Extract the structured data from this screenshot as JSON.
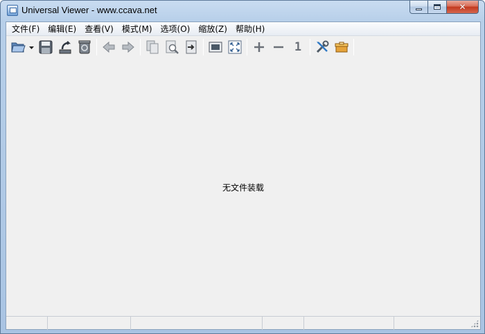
{
  "window": {
    "title": "Universal Viewer - www.ccava.net",
    "buttons": {
      "minimize_icon": "minimize-icon",
      "maximize_icon": "maximize-icon",
      "close_icon": "close-icon",
      "close_glyph": "✕"
    }
  },
  "menu": [
    {
      "label": "文件(F)"
    },
    {
      "label": "编辑(E)"
    },
    {
      "label": "查看(V)"
    },
    {
      "label": "模式(M)"
    },
    {
      "label": "选项(O)"
    },
    {
      "label": "缩放(Z)"
    },
    {
      "label": "帮助(H)"
    }
  ],
  "toolbar": {
    "groups": [
      [
        "open-icon",
        "dropdown-arrow-icon",
        "save-icon",
        "reload-icon",
        "delete-icon"
      ],
      [
        "back-arrow-icon",
        "forward-arrow-icon"
      ],
      [
        "copy-icon",
        "find-icon",
        "exit-to-icon"
      ],
      [
        "fullscreen-window-icon",
        "fit-screen-icon"
      ],
      [
        "zoom-in-icon",
        "zoom-out-icon",
        "original-size-icon"
      ],
      [
        "settings-tools-icon",
        "plugin-box-icon"
      ]
    ],
    "original_size_label": "1"
  },
  "viewer": {
    "empty_message": "无文件装载"
  },
  "statusbar": {
    "panes": [
      "",
      "",
      "",
      "",
      "",
      ""
    ]
  },
  "colors": {
    "frame": "#b7cfe9",
    "client_bg": "#f0f0f0",
    "close_red": "#c2391f"
  }
}
